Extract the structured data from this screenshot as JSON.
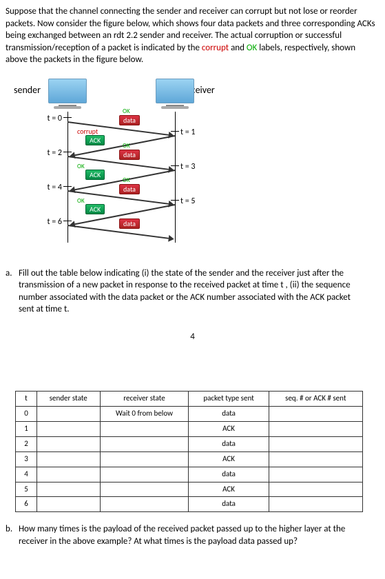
{
  "intro": {
    "p1a": "Suppose that the channel connecting the sender and receiver can corrupt but not lose or reorder packets. Now consider the figure below, which shows four data packets and three corresponding ACKs being exchanged between an rdt 2.2 sender and receiver. The actual corruption or successful transmission/reception of a packet is indicated by the ",
    "corrupt": "corrupt",
    "p1b": " and ",
    "ok": "OK",
    "p1c": " labels, respectively, shown above the packets in the figure below."
  },
  "diagram": {
    "sender": "sender",
    "receiver": "receiver",
    "t0": "t = 0",
    "t1": "t = 1",
    "t2": "t = 2",
    "t3": "t = 3",
    "t4": "t = 4",
    "t5": "t = 5",
    "t6": "t = 6",
    "ok": "OK",
    "corrupt": "corrupt",
    "data": "data",
    "ack": "ACK"
  },
  "qa": {
    "letter": "a.",
    "text": "Fill out the table below indicating (i) the state of the sender and the receiver just after the transmission of a new packet in response to the received packet at time t , (ii) the sequence number associated with the data packet or the ACK number associated with the ACK packet sent at time t."
  },
  "floating4": "4",
  "table": {
    "headers": {
      "t": "t",
      "sender": "sender state",
      "receiver": "receiver state",
      "ptype": "packet type sent",
      "seq": "seq. # or ACK # sent"
    },
    "rows": [
      {
        "t": "0",
        "sender": "",
        "receiver": "Wait 0 from below",
        "ptype": "data",
        "seq": ""
      },
      {
        "t": "1",
        "sender": "",
        "receiver": "",
        "ptype": "ACK",
        "seq": ""
      },
      {
        "t": "2",
        "sender": "",
        "receiver": "",
        "ptype": "data",
        "seq": ""
      },
      {
        "t": "3",
        "sender": "",
        "receiver": "",
        "ptype": "ACK",
        "seq": ""
      },
      {
        "t": "4",
        "sender": "",
        "receiver": "",
        "ptype": "data",
        "seq": ""
      },
      {
        "t": "5",
        "sender": "",
        "receiver": "",
        "ptype": "ACK",
        "seq": ""
      },
      {
        "t": "6",
        "sender": "",
        "receiver": "",
        "ptype": "data",
        "seq": ""
      }
    ]
  },
  "qb": {
    "letter": "b.",
    "text": "How many times is the payload of the received packet passed up to the higher layer at the receiver in the above example? At what times is the payload data passed up?"
  }
}
